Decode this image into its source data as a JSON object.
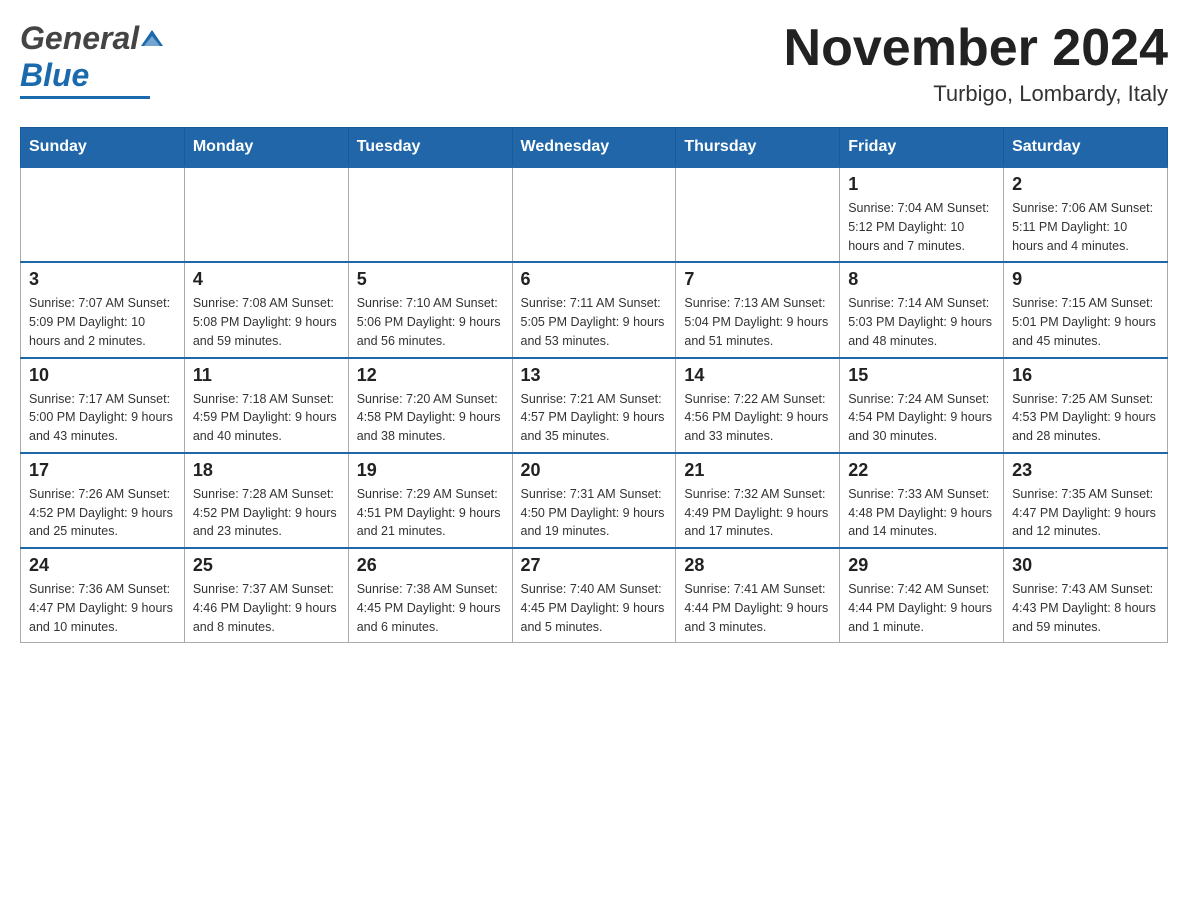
{
  "header": {
    "logo": {
      "general": "General",
      "blue": "Blue",
      "line": true
    },
    "title": "November 2024",
    "location": "Turbigo, Lombardy, Italy"
  },
  "calendar": {
    "headers": [
      "Sunday",
      "Monday",
      "Tuesday",
      "Wednesday",
      "Thursday",
      "Friday",
      "Saturday"
    ],
    "weeks": [
      {
        "days": [
          {
            "date": "",
            "info": ""
          },
          {
            "date": "",
            "info": ""
          },
          {
            "date": "",
            "info": ""
          },
          {
            "date": "",
            "info": ""
          },
          {
            "date": "",
            "info": ""
          },
          {
            "date": "1",
            "info": "Sunrise: 7:04 AM\nSunset: 5:12 PM\nDaylight: 10 hours\nand 7 minutes."
          },
          {
            "date": "2",
            "info": "Sunrise: 7:06 AM\nSunset: 5:11 PM\nDaylight: 10 hours\nand 4 minutes."
          }
        ]
      },
      {
        "days": [
          {
            "date": "3",
            "info": "Sunrise: 7:07 AM\nSunset: 5:09 PM\nDaylight: 10 hours\nand 2 minutes."
          },
          {
            "date": "4",
            "info": "Sunrise: 7:08 AM\nSunset: 5:08 PM\nDaylight: 9 hours\nand 59 minutes."
          },
          {
            "date": "5",
            "info": "Sunrise: 7:10 AM\nSunset: 5:06 PM\nDaylight: 9 hours\nand 56 minutes."
          },
          {
            "date": "6",
            "info": "Sunrise: 7:11 AM\nSunset: 5:05 PM\nDaylight: 9 hours\nand 53 minutes."
          },
          {
            "date": "7",
            "info": "Sunrise: 7:13 AM\nSunset: 5:04 PM\nDaylight: 9 hours\nand 51 minutes."
          },
          {
            "date": "8",
            "info": "Sunrise: 7:14 AM\nSunset: 5:03 PM\nDaylight: 9 hours\nand 48 minutes."
          },
          {
            "date": "9",
            "info": "Sunrise: 7:15 AM\nSunset: 5:01 PM\nDaylight: 9 hours\nand 45 minutes."
          }
        ]
      },
      {
        "days": [
          {
            "date": "10",
            "info": "Sunrise: 7:17 AM\nSunset: 5:00 PM\nDaylight: 9 hours\nand 43 minutes."
          },
          {
            "date": "11",
            "info": "Sunrise: 7:18 AM\nSunset: 4:59 PM\nDaylight: 9 hours\nand 40 minutes."
          },
          {
            "date": "12",
            "info": "Sunrise: 7:20 AM\nSunset: 4:58 PM\nDaylight: 9 hours\nand 38 minutes."
          },
          {
            "date": "13",
            "info": "Sunrise: 7:21 AM\nSunset: 4:57 PM\nDaylight: 9 hours\nand 35 minutes."
          },
          {
            "date": "14",
            "info": "Sunrise: 7:22 AM\nSunset: 4:56 PM\nDaylight: 9 hours\nand 33 minutes."
          },
          {
            "date": "15",
            "info": "Sunrise: 7:24 AM\nSunset: 4:54 PM\nDaylight: 9 hours\nand 30 minutes."
          },
          {
            "date": "16",
            "info": "Sunrise: 7:25 AM\nSunset: 4:53 PM\nDaylight: 9 hours\nand 28 minutes."
          }
        ]
      },
      {
        "days": [
          {
            "date": "17",
            "info": "Sunrise: 7:26 AM\nSunset: 4:52 PM\nDaylight: 9 hours\nand 25 minutes."
          },
          {
            "date": "18",
            "info": "Sunrise: 7:28 AM\nSunset: 4:52 PM\nDaylight: 9 hours\nand 23 minutes."
          },
          {
            "date": "19",
            "info": "Sunrise: 7:29 AM\nSunset: 4:51 PM\nDaylight: 9 hours\nand 21 minutes."
          },
          {
            "date": "20",
            "info": "Sunrise: 7:31 AM\nSunset: 4:50 PM\nDaylight: 9 hours\nand 19 minutes."
          },
          {
            "date": "21",
            "info": "Sunrise: 7:32 AM\nSunset: 4:49 PM\nDaylight: 9 hours\nand 17 minutes."
          },
          {
            "date": "22",
            "info": "Sunrise: 7:33 AM\nSunset: 4:48 PM\nDaylight: 9 hours\nand 14 minutes."
          },
          {
            "date": "23",
            "info": "Sunrise: 7:35 AM\nSunset: 4:47 PM\nDaylight: 9 hours\nand 12 minutes."
          }
        ]
      },
      {
        "days": [
          {
            "date": "24",
            "info": "Sunrise: 7:36 AM\nSunset: 4:47 PM\nDaylight: 9 hours\nand 10 minutes."
          },
          {
            "date": "25",
            "info": "Sunrise: 7:37 AM\nSunset: 4:46 PM\nDaylight: 9 hours\nand 8 minutes."
          },
          {
            "date": "26",
            "info": "Sunrise: 7:38 AM\nSunset: 4:45 PM\nDaylight: 9 hours\nand 6 minutes."
          },
          {
            "date": "27",
            "info": "Sunrise: 7:40 AM\nSunset: 4:45 PM\nDaylight: 9 hours\nand 5 minutes."
          },
          {
            "date": "28",
            "info": "Sunrise: 7:41 AM\nSunset: 4:44 PM\nDaylight: 9 hours\nand 3 minutes."
          },
          {
            "date": "29",
            "info": "Sunrise: 7:42 AM\nSunset: 4:44 PM\nDaylight: 9 hours\nand 1 minute."
          },
          {
            "date": "30",
            "info": "Sunrise: 7:43 AM\nSunset: 4:43 PM\nDaylight: 8 hours\nand 59 minutes."
          }
        ]
      }
    ]
  }
}
